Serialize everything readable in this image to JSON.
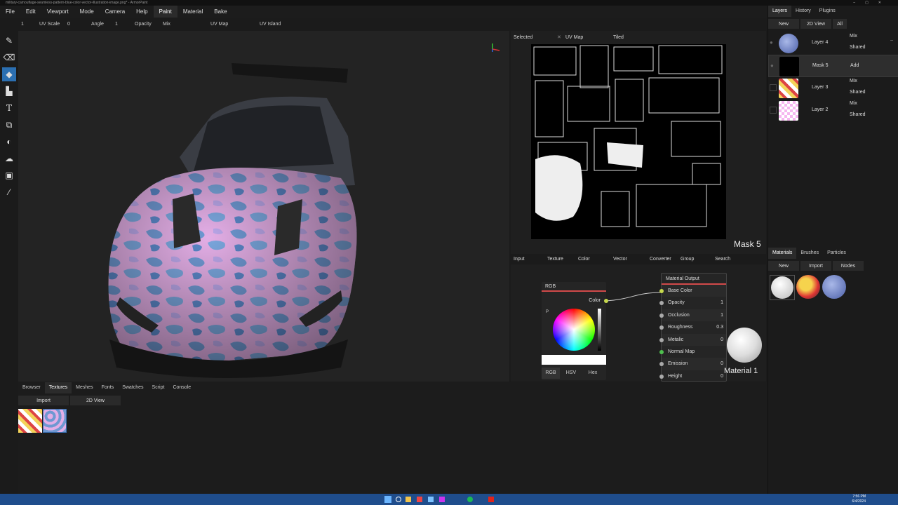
{
  "window": {
    "title": "military-camouflage-seamless-pattern-blue-color-vector-illustration-image.png* - ArmorPaint"
  },
  "menu": [
    {
      "label": "File"
    },
    {
      "label": "Edit"
    },
    {
      "label": "Viewport"
    },
    {
      "label": "Mode"
    },
    {
      "label": "Camera"
    },
    {
      "label": "Help"
    },
    {
      "label": "Paint"
    },
    {
      "label": "Material"
    },
    {
      "label": "Bake"
    }
  ],
  "toolrow": {
    "brush_radius": "1",
    "uv_scale_label": "UV Scale",
    "uv_scale": "0",
    "angle_label": "Angle",
    "angle": "1",
    "opacity_label": "Opacity",
    "blend": "Mix",
    "uv_map": "UV Map",
    "uv_island": "UV Island"
  },
  "tools": [
    {
      "icon": "brush-icon"
    },
    {
      "icon": "eraser-icon"
    },
    {
      "icon": "fill-icon"
    },
    {
      "icon": "decal-icon"
    },
    {
      "icon": "text-icon"
    },
    {
      "icon": "clone-icon"
    },
    {
      "icon": "blur-icon"
    },
    {
      "icon": "smudge-icon"
    },
    {
      "icon": "particle-icon"
    },
    {
      "icon": "picker-icon"
    }
  ],
  "uvpanel": {
    "selected": "Selected",
    "uvmap": "UV Map",
    "tiled": "Tiled",
    "overlay_label": "Mask 5"
  },
  "nodebar": [
    "Input",
    "Texture",
    "Color",
    "Vector",
    "Converter",
    "Group",
    "Search"
  ],
  "rgbnode": {
    "title": "RGB",
    "output": "Color",
    "tabs": [
      "RGB",
      "HSV",
      "Hex"
    ],
    "p_label": "P"
  },
  "output_node": {
    "title": "Material Output",
    "inputs": [
      {
        "name": "Base Color",
        "value": "",
        "color": "#c6d84d"
      },
      {
        "name": "Opacity",
        "value": "1",
        "color": "#aaaaaa"
      },
      {
        "name": "Occlusion",
        "value": "1",
        "color": "#aaaaaa"
      },
      {
        "name": "Roughness",
        "value": "0.3",
        "color": "#aaaaaa"
      },
      {
        "name": "Metalic",
        "value": "0",
        "color": "#aaaaaa"
      },
      {
        "name": "Normal Map",
        "value": "",
        "color": "#4fc04f"
      },
      {
        "name": "Emission",
        "value": "0",
        "color": "#aaaaaa"
      },
      {
        "name": "Height",
        "value": "0",
        "color": "#aaaaaa"
      }
    ]
  },
  "material_preview": {
    "label": "Material 1"
  },
  "right": {
    "tabs": [
      "Layers",
      "History",
      "Plugins"
    ],
    "buttons": [
      "New",
      "2D View",
      "All"
    ],
    "layers": [
      {
        "name": "Layer 4",
        "blend": "Mix",
        "mode": "Shared"
      },
      {
        "name": "Mask 5",
        "blend": "Add",
        "mode": ""
      },
      {
        "name": "Layer 3",
        "blend": "Mix",
        "mode": "Shared"
      },
      {
        "name": "Layer 2",
        "blend": "Mix",
        "mode": "Shared"
      }
    ],
    "mat_tabs": [
      "Materials",
      "Brushes",
      "Particles"
    ],
    "mat_buttons": [
      "New",
      "Import",
      "Nodes"
    ]
  },
  "bottom": {
    "tabs": [
      "Browser",
      "Textures",
      "Meshes",
      "Fonts",
      "Swatches",
      "Script",
      "Console"
    ],
    "buttons": [
      "Import",
      "2D View"
    ]
  },
  "colors": {
    "accent": "#2b6fb1",
    "taskbar": "#1f4d8c",
    "selected_row": "#2e2e2e"
  },
  "taskbar": {
    "clock_time": "7:56 PM",
    "clock_date": "6/4/2024"
  }
}
